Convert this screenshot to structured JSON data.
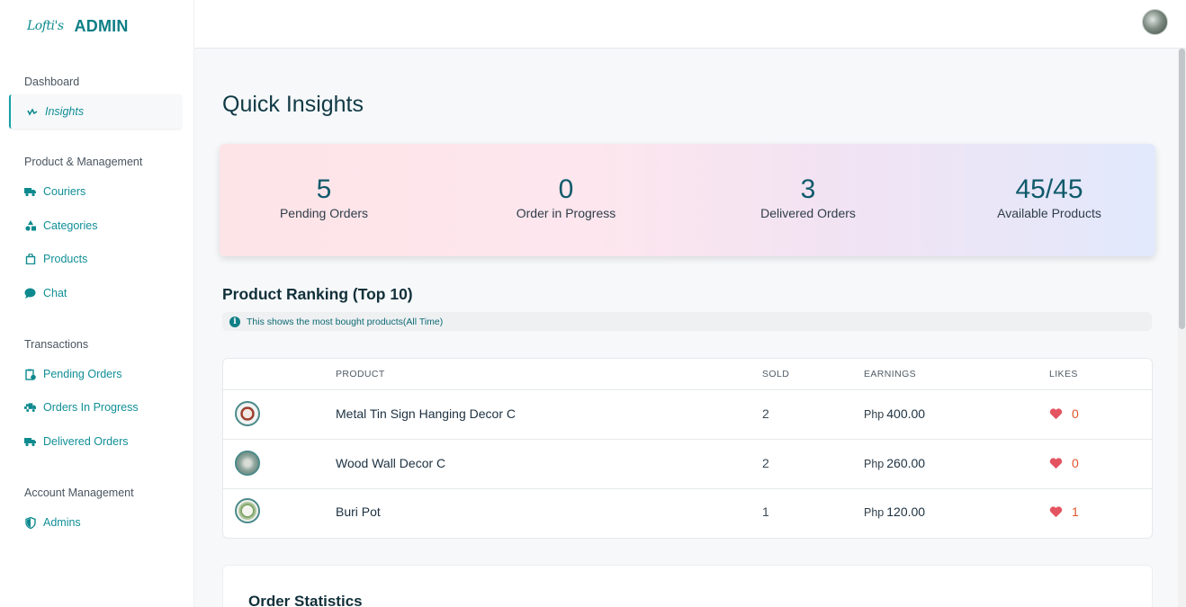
{
  "brand": {
    "logo_text": "Lofti's",
    "title": "ADMIN"
  },
  "sidebar": {
    "sections": [
      {
        "label": "Dashboard"
      },
      {
        "label": "Product & Management"
      },
      {
        "label": "Transactions"
      },
      {
        "label": "Account Management"
      }
    ],
    "items": [
      {
        "label": "Insights",
        "icon": "pulse-icon",
        "active": true
      },
      {
        "label": "Couriers",
        "icon": "truck-icon"
      },
      {
        "label": "Categories",
        "icon": "shapes-icon"
      },
      {
        "label": "Products",
        "icon": "bag-icon"
      },
      {
        "label": "Chat",
        "icon": "chat-bubble-icon"
      },
      {
        "label": "Pending Orders",
        "icon": "clipboard-clock-icon"
      },
      {
        "label": "Orders In Progress",
        "icon": "delivery-truck-icon"
      },
      {
        "label": "Delivered Orders",
        "icon": "truck-icon"
      },
      {
        "label": "Admins",
        "icon": "shield-icon"
      }
    ]
  },
  "main": {
    "title": "Quick Insights",
    "stats": [
      {
        "value": "5",
        "label": "Pending Orders"
      },
      {
        "value": "0",
        "label": "Order in Progress"
      },
      {
        "value": "3",
        "label": "Delivered Orders"
      },
      {
        "value": "45/45",
        "label": "Available Products"
      }
    ],
    "ranking": {
      "title": "Product Ranking (Top 10)",
      "info": "This shows the most bought products(All Time)",
      "columns": [
        "PRODUCT",
        "SOLD",
        "EARNINGS",
        "LIKES"
      ],
      "rows": [
        {
          "product": "Metal Tin Sign Hanging Decor C",
          "sold": "2",
          "currency": "Php",
          "earnings": "400.00",
          "likes": "0"
        },
        {
          "product": "Wood Wall Decor C",
          "sold": "2",
          "currency": "Php",
          "earnings": "260.00",
          "likes": "0"
        },
        {
          "product": "Buri Pot",
          "sold": "1",
          "currency": "Php",
          "earnings": "120.00",
          "likes": "1"
        }
      ]
    },
    "order_stats_title": "Order Statistics"
  },
  "colors": {
    "accent": "#0e8a8f",
    "heart": "#e35460",
    "likes_text": "#e0552c"
  }
}
